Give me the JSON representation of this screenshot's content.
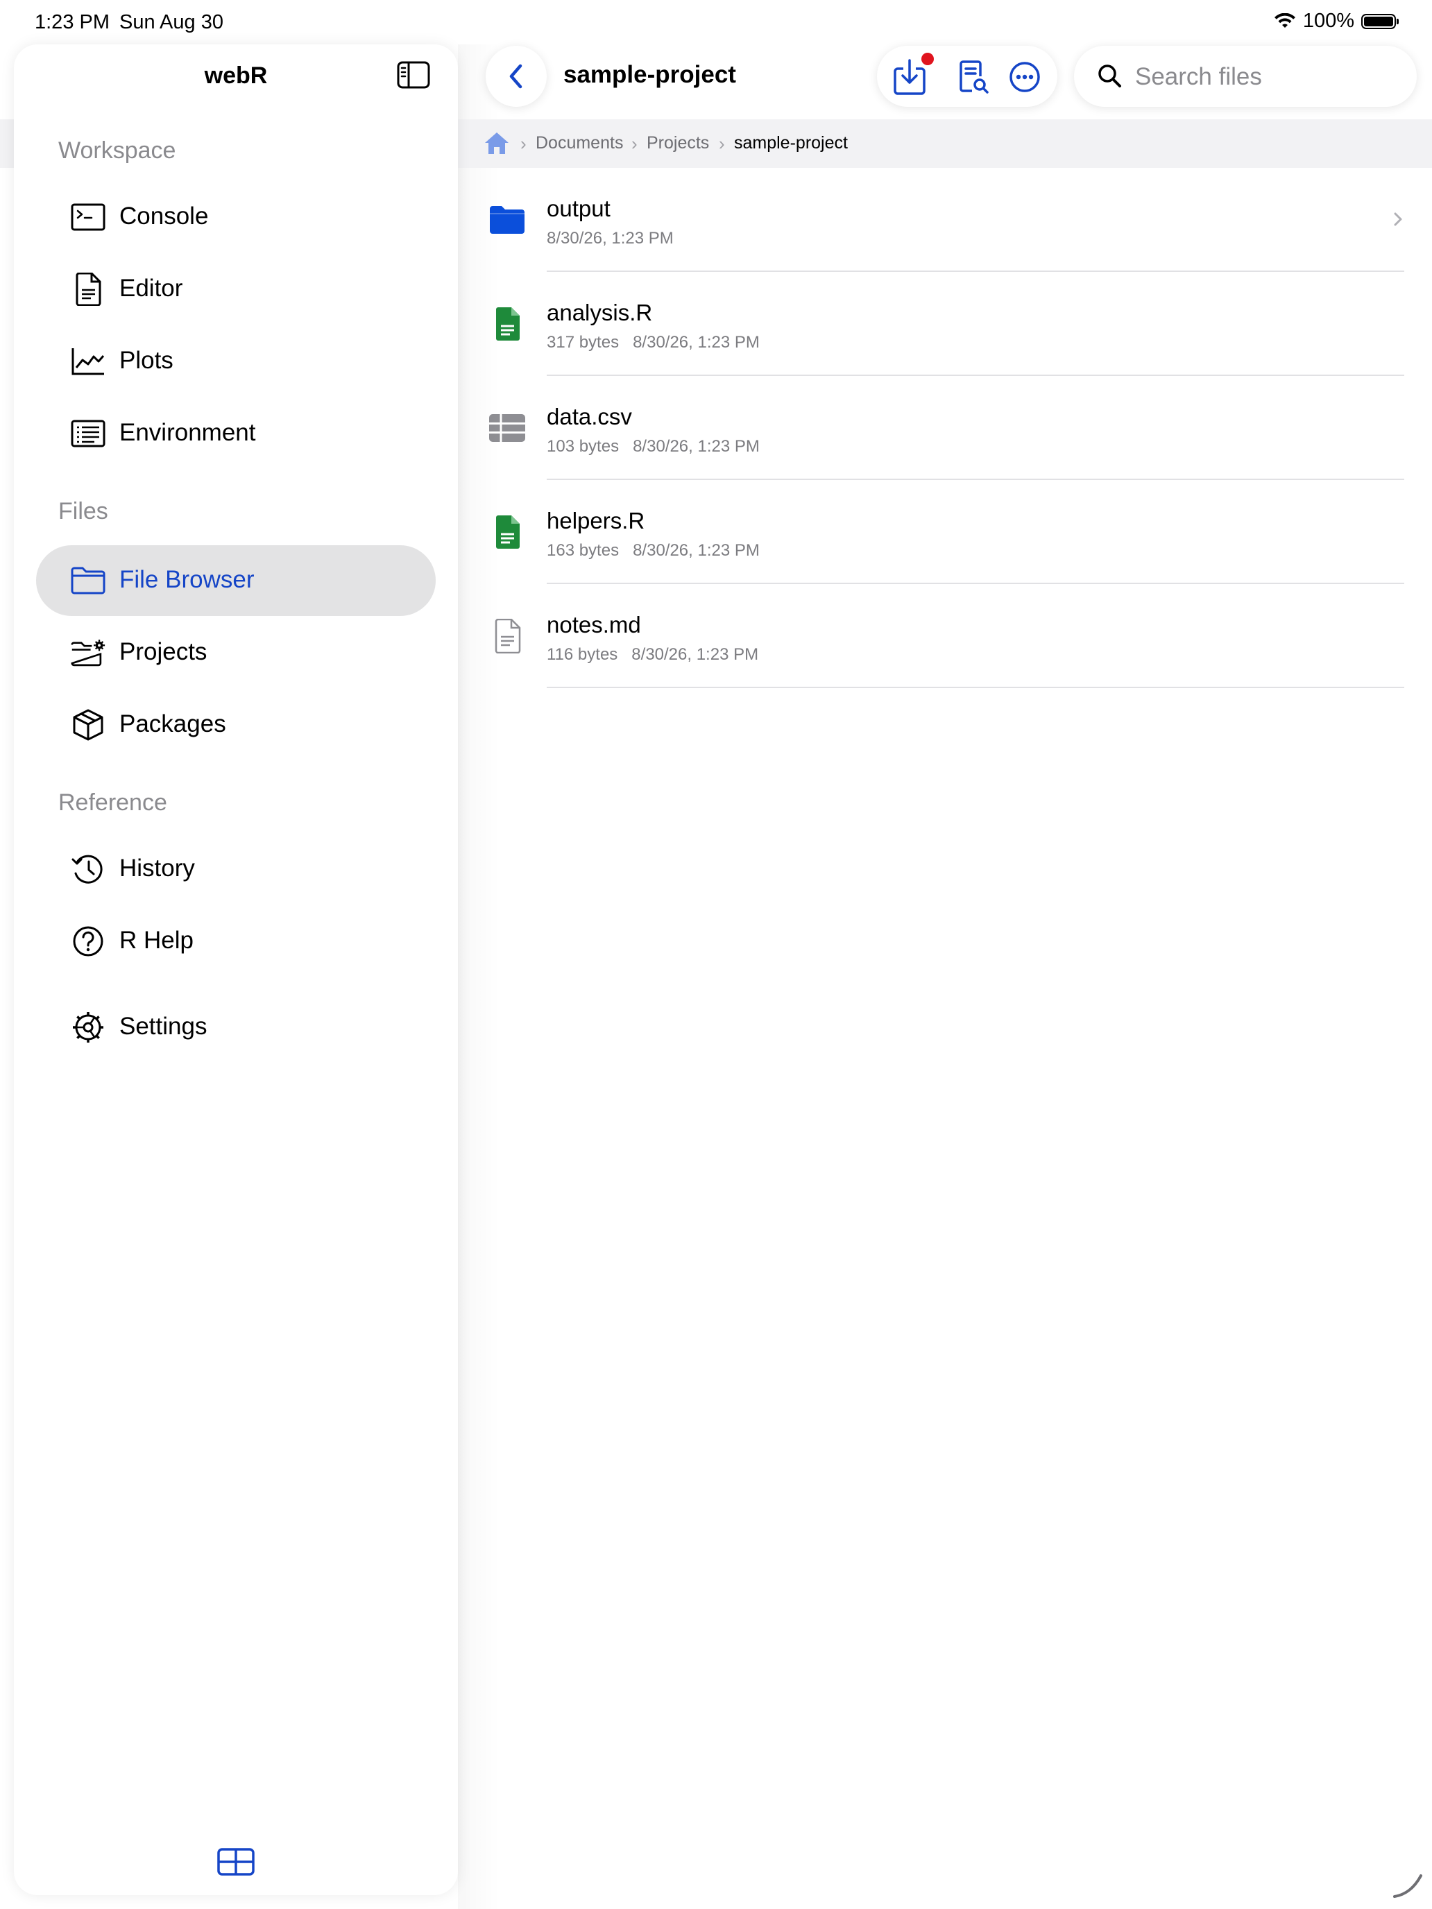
{
  "status_bar": {
    "time": "1:23 PM",
    "date": "Sun Aug 30",
    "battery": "100%"
  },
  "sidebar": {
    "title": "webR",
    "sections": [
      {
        "header": "Workspace",
        "items": [
          {
            "label": "Console",
            "icon": "terminal-icon"
          },
          {
            "label": "Editor",
            "icon": "document-icon"
          },
          {
            "label": "Plots",
            "icon": "chart-line-icon"
          },
          {
            "label": "Environment",
            "icon": "list-icon"
          }
        ]
      },
      {
        "header": "Files",
        "items": [
          {
            "label": "File Browser",
            "icon": "folder-icon",
            "selected": true
          },
          {
            "label": "Projects",
            "icon": "folder-gear-icon"
          },
          {
            "label": "Packages",
            "icon": "cube-icon"
          }
        ]
      },
      {
        "header": "Reference",
        "items": [
          {
            "label": "History",
            "icon": "clock-icon"
          },
          {
            "label": "R Help",
            "icon": "question-icon"
          }
        ]
      },
      {
        "header": "",
        "items": [
          {
            "label": "Settings",
            "icon": "gear-icon"
          }
        ]
      }
    ]
  },
  "header": {
    "title": "sample-project",
    "search_placeholder": "Search files"
  },
  "breadcrumb": [
    "Documents",
    "Projects",
    "sample-project"
  ],
  "files": [
    {
      "name": "output",
      "meta": "8/30/26, 1:23 PM",
      "type": "folder"
    },
    {
      "name": "analysis.R",
      "meta": "317 bytes   8/30/26, 1:23 PM",
      "type": "r-file"
    },
    {
      "name": "data.csv",
      "meta": "103 bytes   8/30/26, 1:23 PM",
      "type": "table"
    },
    {
      "name": "helpers.R",
      "meta": "163 bytes   8/30/26, 1:23 PM",
      "type": "r-file"
    },
    {
      "name": "notes.md",
      "meta": "116 bytes   8/30/26, 1:23 PM",
      "type": "text-file"
    }
  ],
  "colors": {
    "accent": "#1545c7",
    "folder": "#0b4fdb",
    "r_file": "#1e8a3a",
    "badge": "#e0141e",
    "selection": "#e3e3e4"
  }
}
